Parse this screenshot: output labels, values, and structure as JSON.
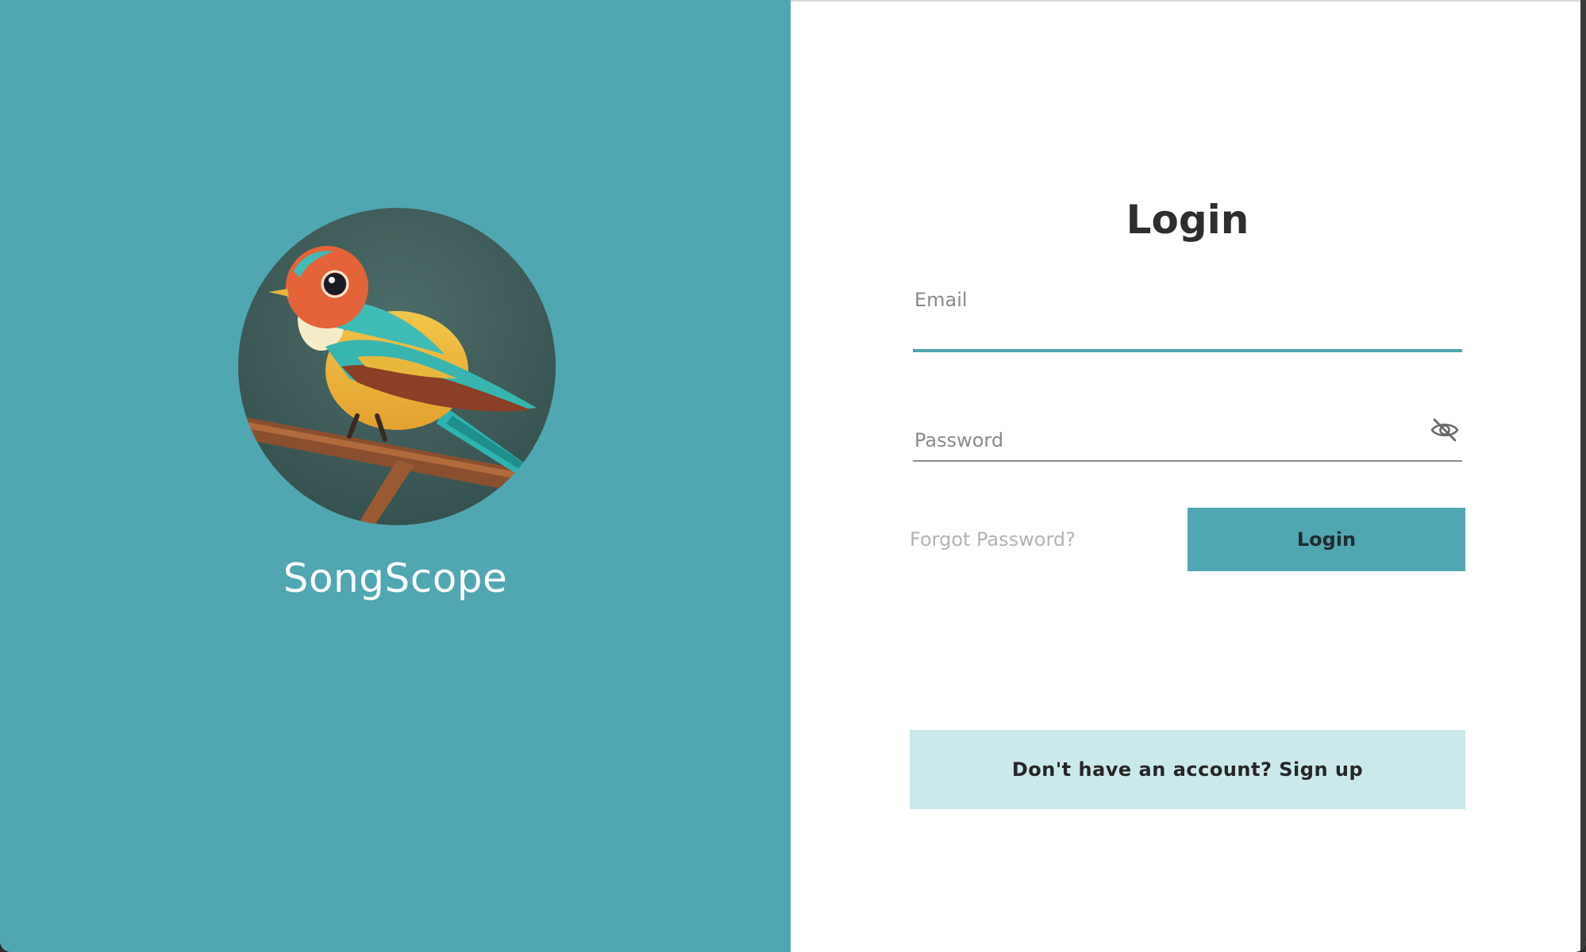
{
  "app": {
    "name": "SongScope",
    "logo_icon": "songbird-on-branch-icon"
  },
  "login_form": {
    "title": "Login",
    "email": {
      "placeholder": "Email",
      "value": ""
    },
    "password": {
      "placeholder": "Password",
      "value": "",
      "visibility_icon": "eye-slash-icon"
    },
    "forgot_password_label": "Forgot Password?",
    "login_button_label": "Login",
    "signup_button_label": "Don't have an account? Sign up"
  },
  "colors": {
    "brand_teal": "#50a6b1",
    "signup_background": "#cbe8eb",
    "title_text": "#2e2e2e",
    "muted_link": "#b3b3b3"
  }
}
